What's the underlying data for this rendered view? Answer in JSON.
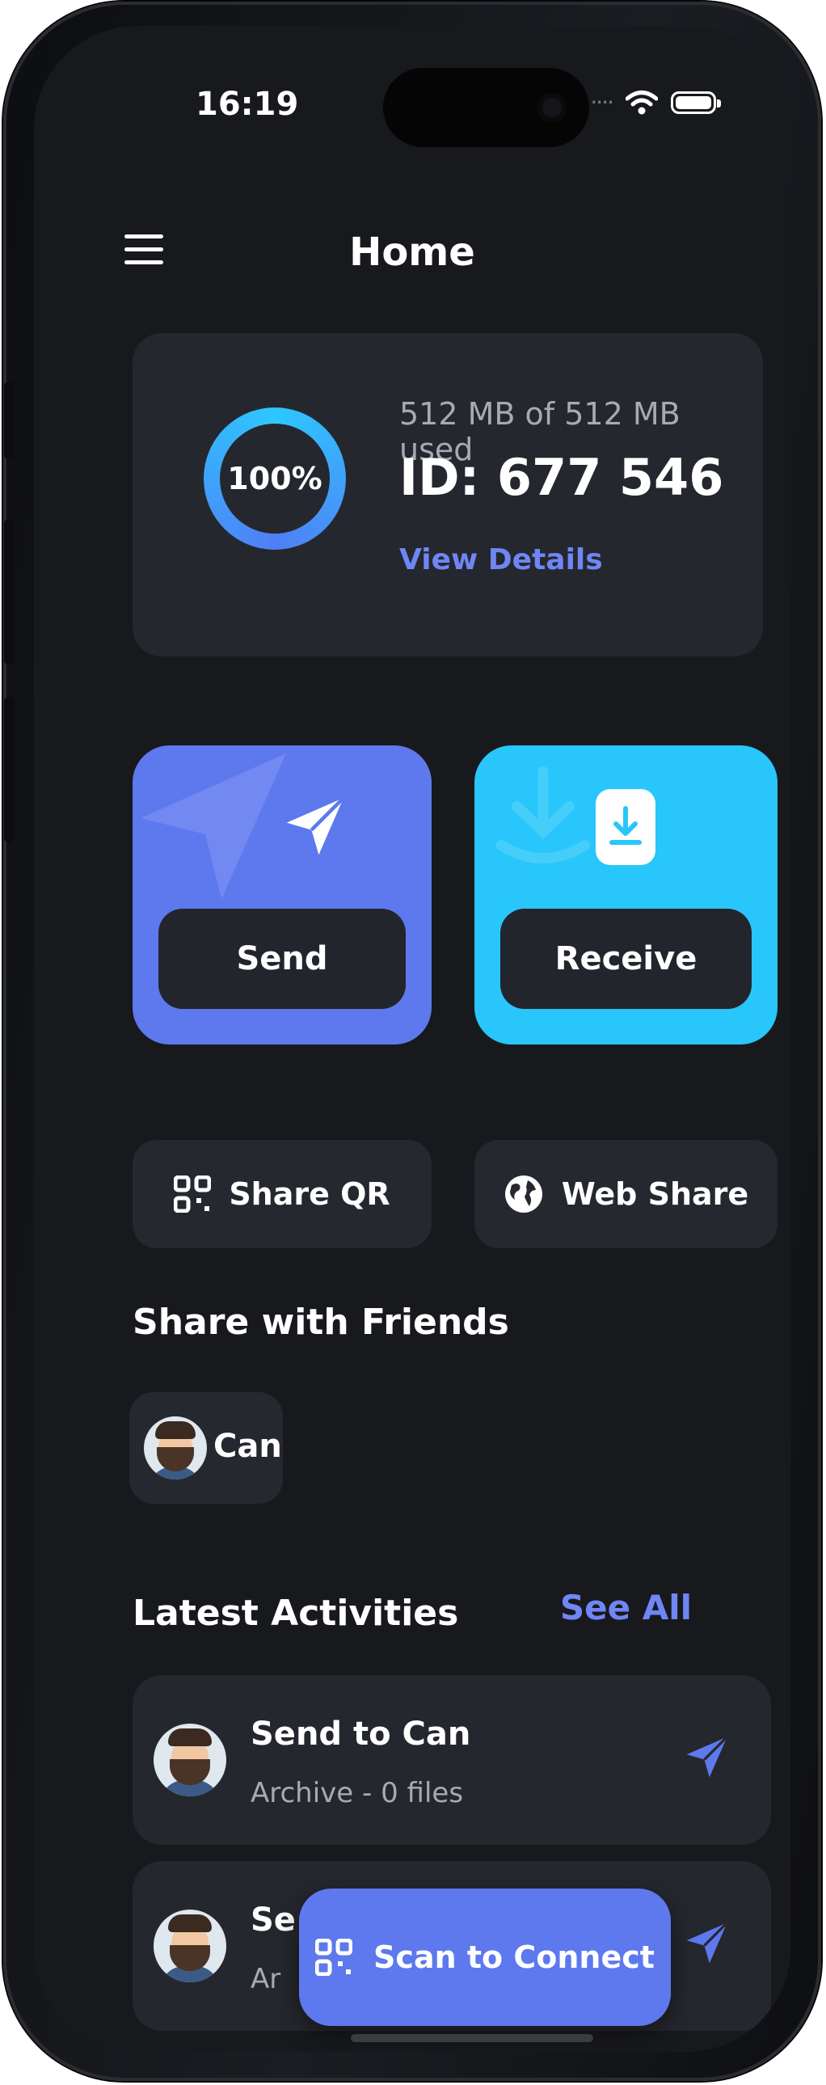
{
  "status_bar": {
    "time": "16:19",
    "signal": "····"
  },
  "header": {
    "title": "Home"
  },
  "storage": {
    "percent_label": "100%",
    "usage_text": "512 MB of 512 MB used",
    "device_id": "ID: 677 546",
    "details_link": "View Details"
  },
  "actions": {
    "send_label": "Send",
    "receive_label": "Receive"
  },
  "shortcuts": {
    "share_qr_label": "Share QR",
    "web_share_label": "Web Share"
  },
  "friends": {
    "title": "Share with Friends",
    "items": [
      {
        "name": "Can"
      }
    ]
  },
  "activities": {
    "title": "Latest Activities",
    "see_all": "See All",
    "items": [
      {
        "title": "Send to Can",
        "subtitle": "Archive - 0 files"
      },
      {
        "title": "Se",
        "subtitle": "Ar"
      }
    ]
  },
  "fab": {
    "label": "Scan to Connect"
  },
  "colors": {
    "accent": "#5e79ee",
    "receive": "#28c6fb",
    "background": "#18191d",
    "card": "#25272e"
  }
}
